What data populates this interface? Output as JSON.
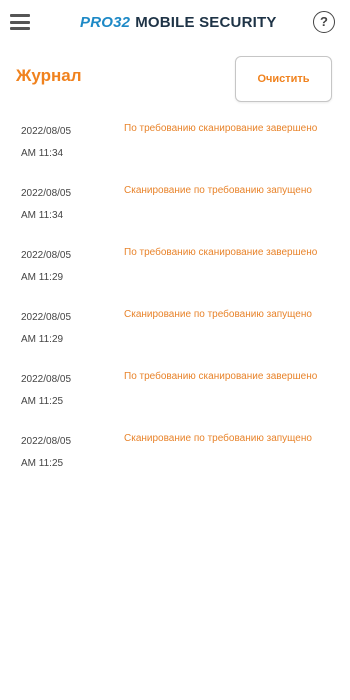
{
  "header": {
    "menu_icon": "hamburger-menu-icon",
    "brand_prefix": "PRO32",
    "brand_suffix": "MOBILE SECURITY",
    "help_label": "?"
  },
  "colors": {
    "accent": "#f0821e",
    "brand_blue": "#1d89c6",
    "brand_dark": "#1e3346"
  },
  "page": {
    "title": "Журнал",
    "clear_button": "Очистить"
  },
  "log_entries": [
    {
      "date": "2022/08/05",
      "time": "AM 11:34",
      "message": "По требованию сканирование завершено"
    },
    {
      "date": "2022/08/05",
      "time": "AM 11:34",
      "message": "Сканирование по требованию запущено"
    },
    {
      "date": "2022/08/05",
      "time": "AM 11:29",
      "message": "По требованию сканирование завершено"
    },
    {
      "date": "2022/08/05",
      "time": "AM 11:29",
      "message": "Сканирование по требованию запущено"
    },
    {
      "date": "2022/08/05",
      "time": "AM 11:25",
      "message": "По требованию сканирование завершено"
    },
    {
      "date": "2022/08/05",
      "time": "AM 11:25",
      "message": "Сканирование по требованию запущено"
    }
  ]
}
